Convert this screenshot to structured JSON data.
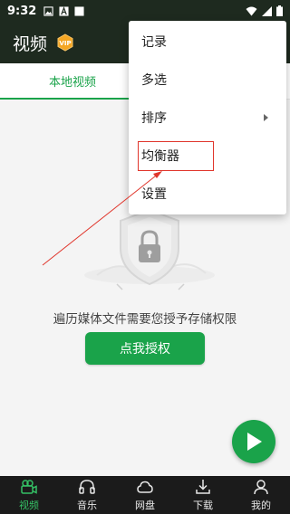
{
  "status_bar": {
    "time": "9:32",
    "icons": [
      "image-icon",
      "a-icon",
      "square-icon"
    ],
    "right_icons": [
      "wifi-icon",
      "signal-icon",
      "battery-icon"
    ]
  },
  "app_bar": {
    "title": "视频",
    "badge_icon": "vip-icon",
    "badge_text": "VIP"
  },
  "tabs": [
    {
      "label": "本地视频",
      "active": true
    },
    {
      "label": "",
      "active": false
    }
  ],
  "empty_state": {
    "message": "遍历媒体文件需要您授予存储权限",
    "button_label": "点我授权",
    "illustration_icon": "lock-shield-icon"
  },
  "fab": {
    "icon": "play-icon"
  },
  "bottom_nav": [
    {
      "label": "视频",
      "icon": "video-icon",
      "active": true
    },
    {
      "label": "音乐",
      "icon": "headphones-icon",
      "active": false
    },
    {
      "label": "网盘",
      "icon": "cloud-icon",
      "active": false
    },
    {
      "label": "下载",
      "icon": "download-icon",
      "active": false
    },
    {
      "label": "我的",
      "icon": "user-icon",
      "active": false
    }
  ],
  "menu": {
    "items": [
      {
        "label": "记录",
        "has_submenu": false
      },
      {
        "label": "多选",
        "has_submenu": false
      },
      {
        "label": "排序",
        "has_submenu": true
      },
      {
        "label": "均衡器",
        "has_submenu": false,
        "highlighted": true
      },
      {
        "label": "设置",
        "has_submenu": false
      }
    ]
  },
  "colors": {
    "accent": "#1aa34a",
    "header": "#1e2a1f",
    "nav_bg": "#1b1b1b",
    "annotation": "#e0352b"
  }
}
